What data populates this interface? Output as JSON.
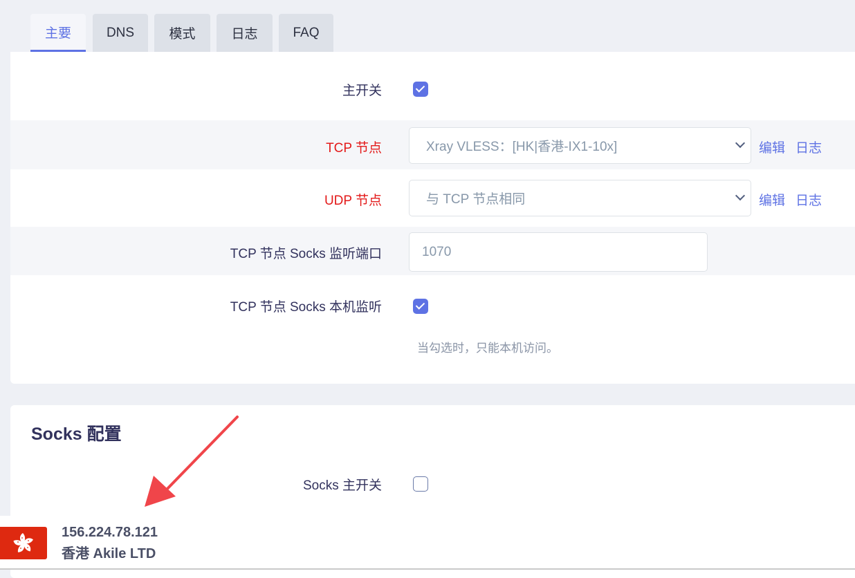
{
  "tabs": [
    {
      "label": "主要",
      "active": true
    },
    {
      "label": "DNS",
      "active": false
    },
    {
      "label": "模式",
      "active": false
    },
    {
      "label": "日志",
      "active": false
    },
    {
      "label": "FAQ",
      "active": false
    }
  ],
  "main": {
    "master_switch": {
      "label": "主开关",
      "checked": true
    },
    "tcp_node": {
      "label": "TCP 节点",
      "value": "Xray VLESS：[HK|香港-IX1-10x]",
      "edit_label": "编辑",
      "log_label": "日志"
    },
    "udp_node": {
      "label": "UDP 节点",
      "value": "与 TCP 节点相同",
      "edit_label": "编辑",
      "log_label": "日志"
    },
    "socks_port": {
      "label": "TCP 节点 Socks 监听端口",
      "value": "1070"
    },
    "socks_local": {
      "label": "TCP 节点 Socks 本机监听",
      "checked": true,
      "hint": "当勾选时，只能本机访问。"
    }
  },
  "socks_config": {
    "title": "Socks 配置",
    "master_switch": {
      "label": "Socks 主开关",
      "checked": false
    }
  },
  "ip_info": {
    "ip": "156.224.78.121",
    "location": "香港 Akile LTD",
    "flag_icon": "hong-kong-flag-icon"
  },
  "colors": {
    "accent": "#5e72e4",
    "required_label": "#e31a1a",
    "annotation_arrow": "#f0454a",
    "flag_red": "#de2910"
  }
}
